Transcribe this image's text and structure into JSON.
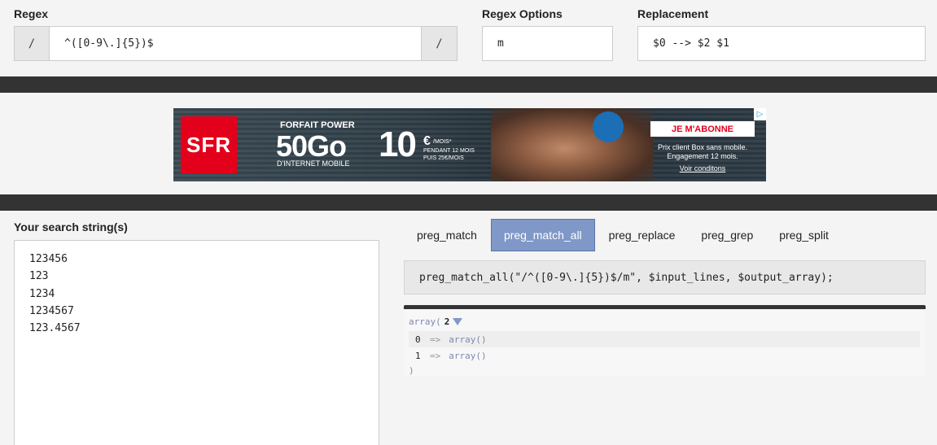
{
  "regex": {
    "label": "Regex",
    "left_delim": "/",
    "right_delim": "/",
    "pattern": "^([0-9\\.]{5})$"
  },
  "options": {
    "label": "Regex Options",
    "value": "m"
  },
  "replacement": {
    "label": "Replacement",
    "value": "$0 --> $2 $1"
  },
  "ad": {
    "brand": "SFR",
    "forfait": "FORFAIT POWER",
    "data_amount": "50Go",
    "internet": "D'INTERNET MOBILE",
    "price": "10",
    "currency": "€",
    "per_month": "/MOIS*",
    "duration": "PENDANT 12 MOIS PUIS 25€/MOIS",
    "cta": "JE M'ABONNE",
    "fine_print": "Prix client Box sans mobile. Engagement 12 mois.",
    "link": "Voir conditons"
  },
  "search": {
    "label": "Your search string(s)",
    "lines": [
      "123456",
      "123",
      "1234",
      "1234567",
      "123.4567"
    ]
  },
  "tabs": [
    {
      "label": "preg_match",
      "active": false
    },
    {
      "label": "preg_match_all",
      "active": true
    },
    {
      "label": "preg_replace",
      "active": false
    },
    {
      "label": "preg_grep",
      "active": false
    },
    {
      "label": "preg_split",
      "active": false
    }
  ],
  "code": "preg_match_all(\"/^([0-9\\.]{5})$/m\", $input_lines, $output_array);",
  "output": {
    "head": "array(",
    "count": "2",
    "rows": [
      {
        "key": "0",
        "arrow": "=>",
        "value": "array()"
      },
      {
        "key": "1",
        "arrow": "=>",
        "value": "array()"
      }
    ],
    "close": ")"
  },
  "colors": {
    "active_tab": "#7f98c7",
    "dark_bar": "#333333",
    "sfr_red": "#e3001b"
  }
}
